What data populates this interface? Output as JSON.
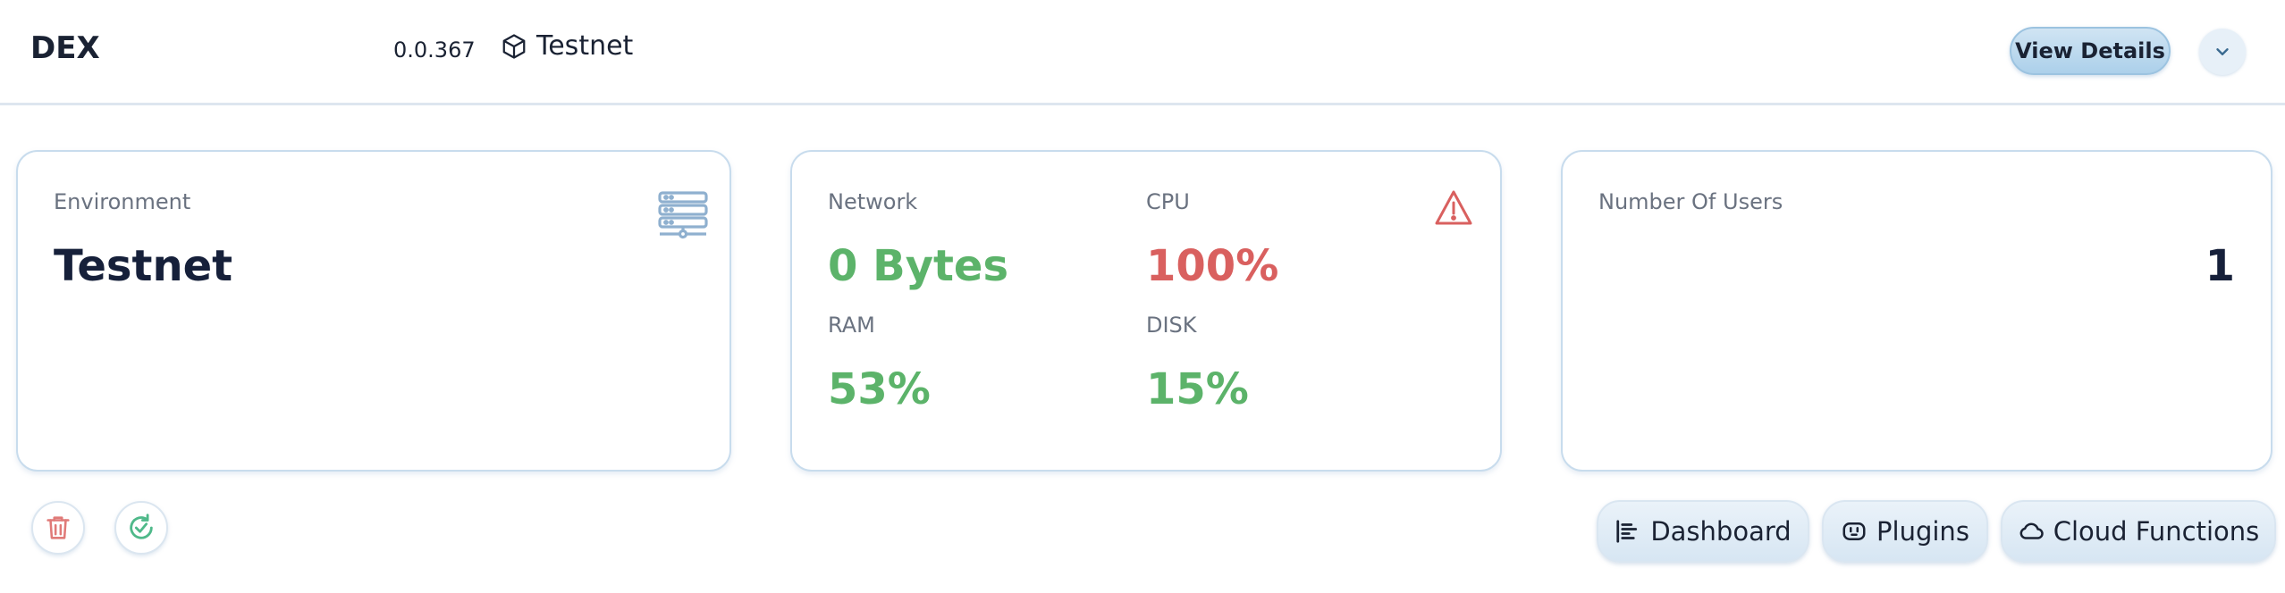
{
  "header": {
    "app_title": "DEX",
    "version": "0.0.367",
    "network": "Testnet",
    "view_details_label": "View Details"
  },
  "environment_card": {
    "label": "Environment",
    "value": "Testnet"
  },
  "stats_card": {
    "network_label": "Network",
    "network_value": "0 Bytes",
    "cpu_label": "CPU",
    "cpu_value": "100%",
    "ram_label": "RAM",
    "ram_value": "53%",
    "disk_label": "DISK",
    "disk_value": "15%"
  },
  "users_card": {
    "label": "Number Of Users",
    "value": "1"
  },
  "footer_nav": {
    "dashboard_label": "Dashboard",
    "plugins_label": "Plugins",
    "cloud_functions_label": "Cloud Functions"
  },
  "icons": {
    "network": "cube-icon",
    "dropdown": "chevron-down-icon",
    "environment": "server-icon",
    "alert": "warning-icon",
    "delete": "trash-icon",
    "refresh": "refresh-check-icon",
    "dashboard": "bar-chart-icon",
    "plugins": "plug-icon",
    "cloud": "cloud-icon"
  },
  "colors": {
    "ok": "#5cb36a",
    "alert": "#d9605f",
    "accent": "#acd0ea"
  }
}
